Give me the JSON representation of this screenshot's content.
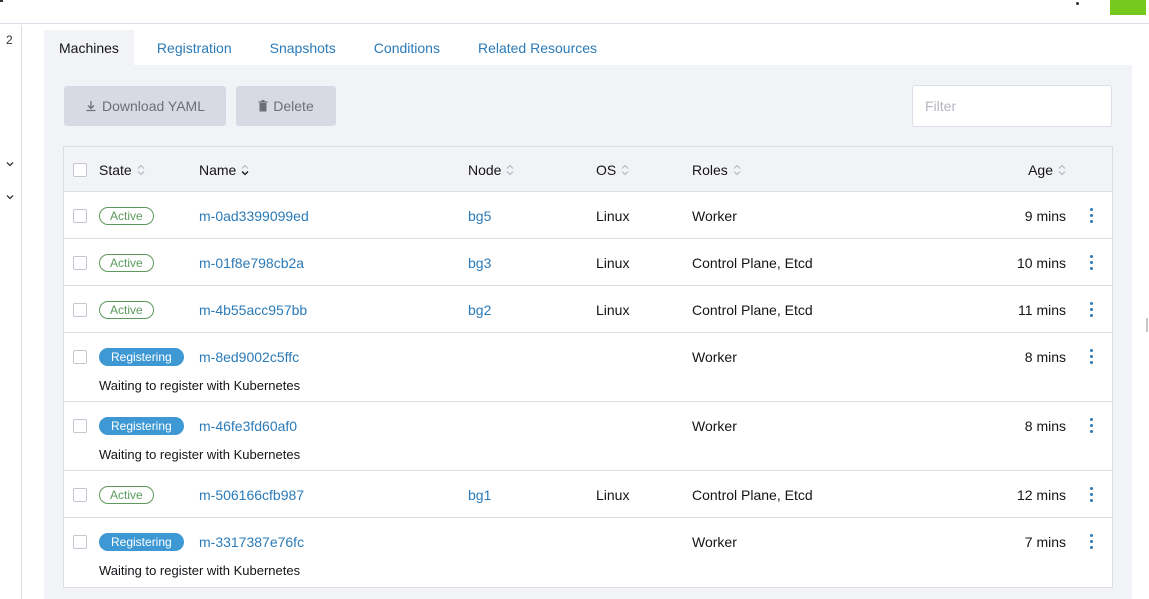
{
  "sidebar": {
    "count": "2"
  },
  "tabs": [
    {
      "label": "Machines",
      "active": true
    },
    {
      "label": "Registration",
      "active": false
    },
    {
      "label": "Snapshots",
      "active": false
    },
    {
      "label": "Conditions",
      "active": false
    },
    {
      "label": "Related Resources",
      "active": false
    }
  ],
  "toolbar": {
    "download_label": "Download YAML",
    "delete_label": "Delete",
    "filter_placeholder": "Filter"
  },
  "table": {
    "headers": {
      "state": "State",
      "name": "Name",
      "node": "Node",
      "os": "OS",
      "roles": "Roles",
      "age": "Age"
    },
    "rows": [
      {
        "state": "Active",
        "name": "m-0ad3399099ed",
        "node": "bg5",
        "os": "Linux",
        "roles": "Worker",
        "age": "9 mins",
        "message": ""
      },
      {
        "state": "Active",
        "name": "m-01f8e798cb2a",
        "node": "bg3",
        "os": "Linux",
        "roles": "Control Plane, Etcd",
        "age": "10 mins",
        "message": ""
      },
      {
        "state": "Active",
        "name": "m-4b55acc957bb",
        "node": "bg2",
        "os": "Linux",
        "roles": "Control Plane, Etcd",
        "age": "11 mins",
        "message": ""
      },
      {
        "state": "Registering",
        "name": "m-8ed9002c5ffc",
        "node": "",
        "os": "",
        "roles": "Worker",
        "age": "8 mins",
        "message": "Waiting to register with Kubernetes"
      },
      {
        "state": "Registering",
        "name": "m-46fe3fd60af0",
        "node": "",
        "os": "",
        "roles": "Worker",
        "age": "8 mins",
        "message": "Waiting to register with Kubernetes"
      },
      {
        "state": "Active",
        "name": "m-506166cfb987",
        "node": "bg1",
        "os": "Linux",
        "roles": "Control Plane, Etcd",
        "age": "12 mins",
        "message": ""
      },
      {
        "state": "Registering",
        "name": "m-3317387e76fc",
        "node": "",
        "os": "",
        "roles": "Worker",
        "age": "7 mins",
        "message": "Waiting to register with Kubernetes"
      }
    ]
  },
  "colors": {
    "link": "#2b7bb9",
    "active_badge": "#5d995d",
    "registering_badge": "#3d98d3",
    "top_accent": "#78c91e"
  }
}
